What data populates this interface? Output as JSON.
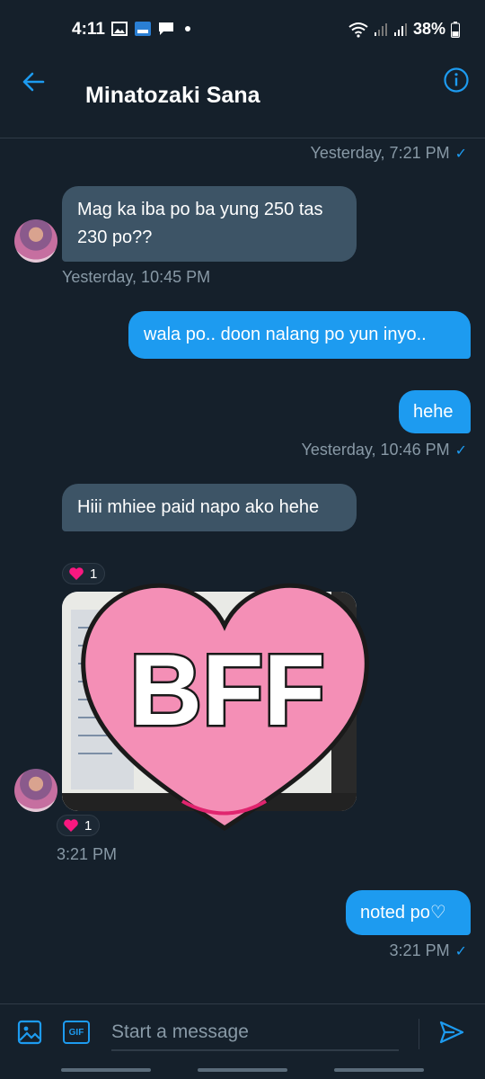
{
  "status_bar": {
    "time": "4:11",
    "battery": "38%"
  },
  "header": {
    "title": "Minatozaki Sana"
  },
  "messages": {
    "m0_meta": "Yesterday, 7:21 PM",
    "m1_text": "Mag ka iba po ba yung 250 tas 230 po??",
    "m1_meta": "Yesterday, 10:45 PM",
    "m2_text": "wala po.. doon nalang po yun inyo..",
    "m3_text": "hehe",
    "m3_meta": "Yesterday, 10:46 PM",
    "m4_text": "Hiii mhiee paid napo ako hehe",
    "m4_reaction_count": "1",
    "m5_sticker_text": "BFF",
    "m5_reaction_count": "1",
    "m5_meta": "3:21 PM",
    "m6_text": "noted po♡",
    "m6_meta": "3:21 PM"
  },
  "composer": {
    "placeholder": "Start a message",
    "gif_label": "GIF"
  },
  "colors": {
    "background": "#15202b",
    "accent": "#1d9bf0",
    "incoming": "#3d5466",
    "sticker_pink": "#f48fb6"
  }
}
